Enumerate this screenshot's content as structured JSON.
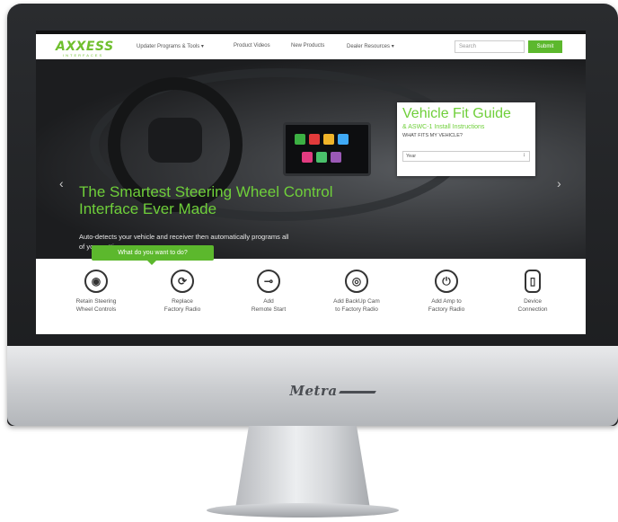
{
  "site": {
    "logo": "AXXESS",
    "logo_sub": "INTERFACES"
  },
  "nav": {
    "items": [
      "Updater Programs & Tools ▾",
      "Product Videos",
      "New Products",
      "Dealer Resources ▾"
    ],
    "search_placeholder": "Search",
    "submit_label": "Submit"
  },
  "hero": {
    "title": "The Smartest Steering Wheel Control Interface Ever Made",
    "description": "Auto-detects your vehicle and receiver then automatically programs all of your settings.",
    "prev_arrow": "‹",
    "next_arrow": "›",
    "slides_total": 4,
    "slide_active": 2
  },
  "fit_guide": {
    "title": "Vehicle Fit Guide",
    "subtitle": "& ASWC-1 Install Instructions",
    "question": "WHAT FITS MY VEHICLE?",
    "year_label": "Year",
    "caret": "↕"
  },
  "callout": {
    "label": "What do you want to do?"
  },
  "features": [
    {
      "label": "Retain Steering\nWheel Controls",
      "icon": "steering-wheel-icon",
      "glyph": "◉"
    },
    {
      "label": "Replace\nFactory Radio",
      "icon": "replace-icon",
      "glyph": "⟳"
    },
    {
      "label": "Add\nRemote Start",
      "icon": "key-icon",
      "glyph": "⊸"
    },
    {
      "label": "Add BackUp Cam\nto Factory Radio",
      "icon": "eye-icon",
      "glyph": "◎"
    },
    {
      "label": "Add Amp to\nFactory Radio",
      "icon": "power-icon",
      "glyph": "⏻"
    },
    {
      "label": "Device\nConnection",
      "icon": "phone-icon",
      "glyph": "▯"
    }
  ],
  "monitor": {
    "brand": "Metra"
  },
  "colors": {
    "accent": "#5cb82d",
    "hero_text": "#6fcf3a"
  }
}
